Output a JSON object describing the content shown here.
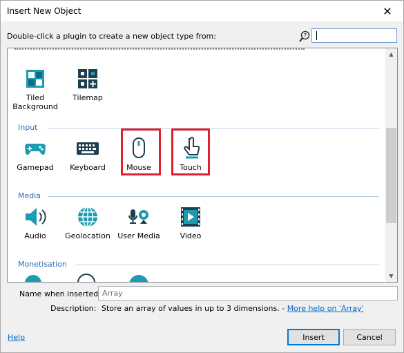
{
  "window": {
    "title": "Insert New Object",
    "close_glyph": "✕"
  },
  "instruction": "Double-click a plugin to create a new object type from:",
  "search": {
    "value": ""
  },
  "colors": {
    "accent": "#2a6db8",
    "highlight": "#e0202e",
    "icon": "#1e9bb3"
  },
  "sections": [
    {
      "items": [
        {
          "label": "Tiled Background",
          "icon": "tiled-background-icon"
        },
        {
          "label": "Tilemap",
          "icon": "tilemap-icon"
        }
      ]
    },
    {
      "title": "Input",
      "items": [
        {
          "label": "Gamepad",
          "icon": "gamepad-icon"
        },
        {
          "label": "Keyboard",
          "icon": "keyboard-icon"
        },
        {
          "label": "Mouse",
          "icon": "mouse-icon",
          "highlighted": true
        },
        {
          "label": "Touch",
          "icon": "touch-icon",
          "highlighted": true
        }
      ]
    },
    {
      "title": "Media",
      "items": [
        {
          "label": "Audio",
          "icon": "audio-icon"
        },
        {
          "label": "Geolocation",
          "icon": "geolocation-icon"
        },
        {
          "label": "User Media",
          "icon": "user-media-icon"
        },
        {
          "label": "Video",
          "icon": "video-icon"
        }
      ]
    },
    {
      "title": "Monetisation"
    }
  ],
  "name_field": {
    "label": "Name when inserted:",
    "value": "Array"
  },
  "description": {
    "label": "Description:",
    "text": "Store an array of values in up to 3 dimensions. - ",
    "link": "More help on 'Array'"
  },
  "footer": {
    "help": "Help",
    "insert": "Insert",
    "cancel": "Cancel"
  }
}
